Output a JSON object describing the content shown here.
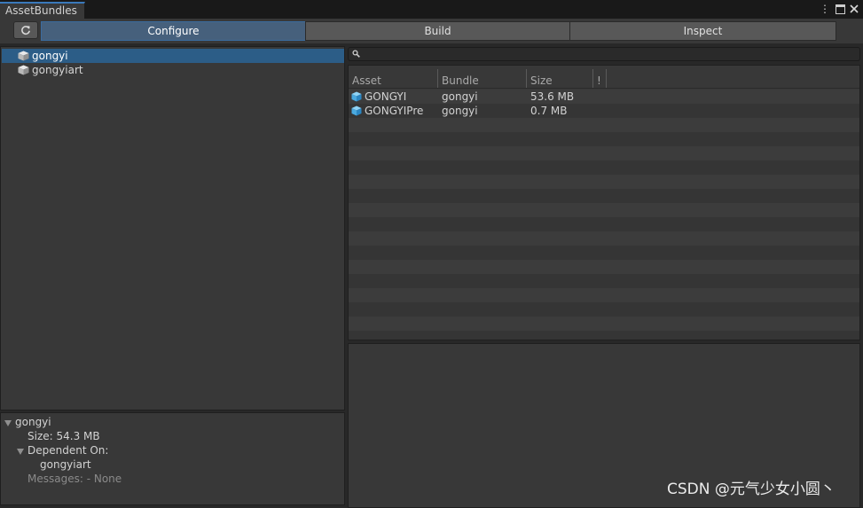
{
  "window": {
    "tab_title": "AssetBundles",
    "menu_icon": "kebab-menu-icon",
    "maximize_icon": "maximize-icon",
    "close_icon": "close-icon"
  },
  "toolbar": {
    "refresh_icon": "refresh-icon",
    "tabs": [
      {
        "label": "Configure",
        "active": true
      },
      {
        "label": "Build",
        "active": false
      },
      {
        "label": "Inspect",
        "active": false
      }
    ]
  },
  "bundle_tree": {
    "items": [
      {
        "label": "gongyi",
        "selected": true,
        "icon": "bundle-cube-icon"
      },
      {
        "label": "gongyiart",
        "selected": false,
        "icon": "bundle-cube-icon"
      }
    ]
  },
  "bundle_info": {
    "name": "gongyi",
    "size_line": "Size: 54.3 MB",
    "dependent_label": "Dependent On:",
    "dependency": "gongyiart",
    "messages_line": "Messages: - None"
  },
  "asset_list": {
    "search_value": "",
    "columns": [
      "Asset",
      "Bundle",
      "Size",
      "!"
    ],
    "rows": [
      {
        "asset": "GONGYI",
        "bundle": "gongyi",
        "size": "53.6 MB",
        "icon": "prefab-cube-icon"
      },
      {
        "asset": "GONGYIPre",
        "bundle": "gongyi",
        "size": "0.7 MB",
        "icon": "prefab-cube-icon"
      }
    ]
  },
  "watermark": "CSDN @元气少女小圆丶",
  "colors": {
    "accent": "#3a79bb",
    "selection": "#2c5d87",
    "active_tab": "#46607c",
    "panel": "#383838",
    "background": "#282828"
  }
}
